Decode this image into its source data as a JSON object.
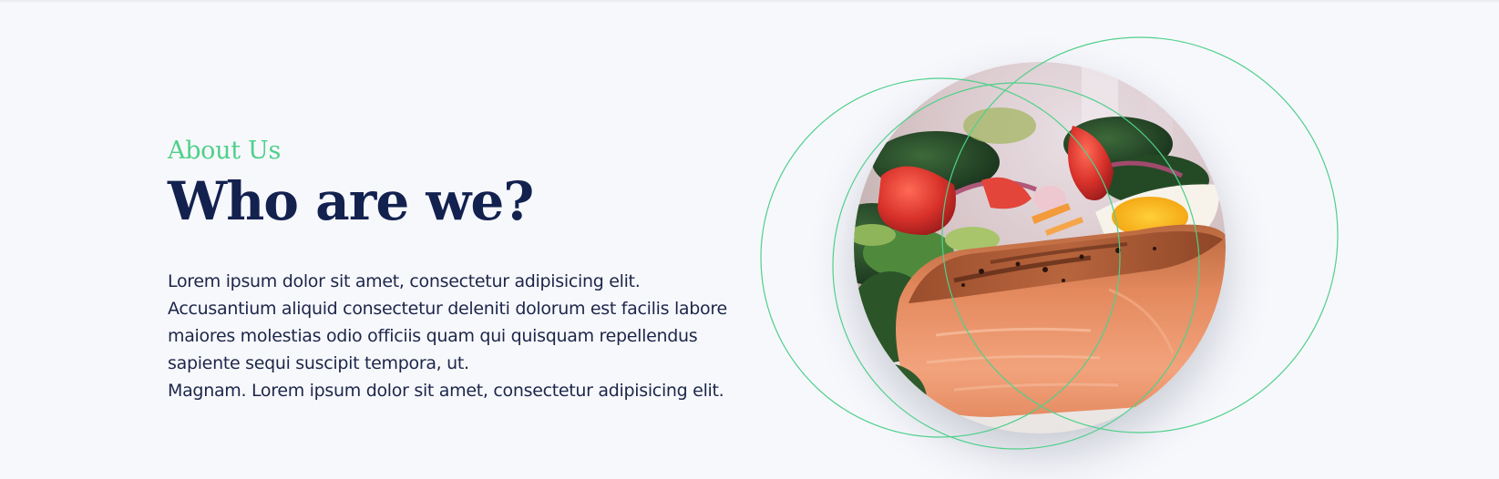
{
  "about": {
    "eyebrow": "About Us",
    "title": "Who are we?",
    "body_lines": [
      "Lorem ipsum dolor sit amet, consectetur adipisicing elit.",
      "Accusantium aliquid consectetur deleniti dolorum est facilis labore",
      "maiores molestias odio officiis quam qui quisquam repellendus",
      "sapiente sequi suscipit tempora, ut.",
      "Magnam. Lorem ipsum dolor sit amet, consectetur adipisicing elit."
    ]
  },
  "colors": {
    "accent": "#4fd08a",
    "heading": "#13214f",
    "body_text": "#1c2649",
    "background": "#f7f8fc"
  },
  "image": {
    "subject": "grilled-salmon-with-salad"
  }
}
